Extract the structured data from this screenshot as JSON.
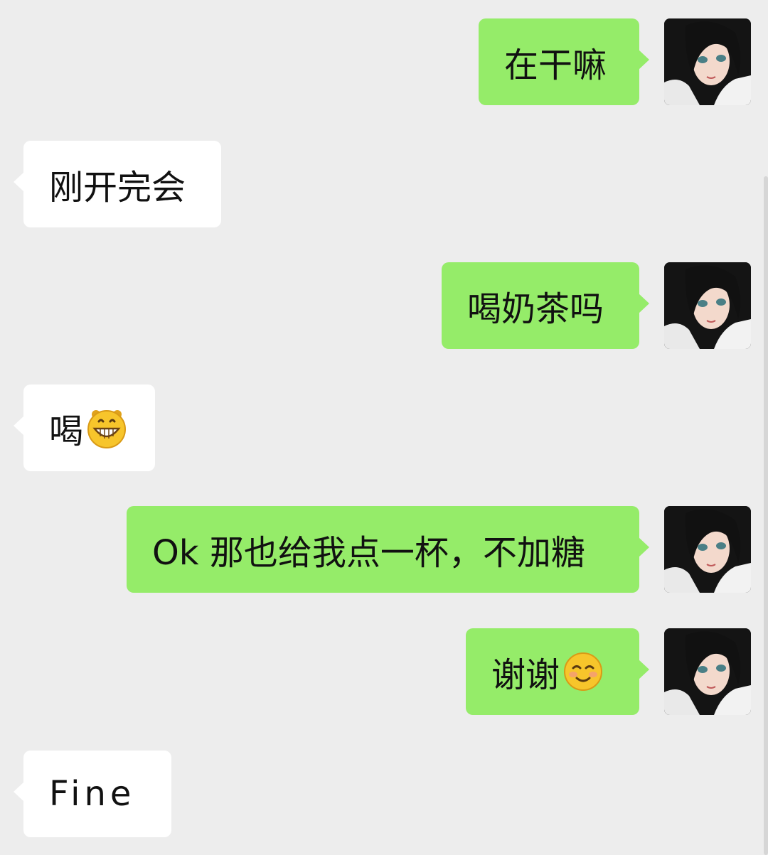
{
  "messages": [
    {
      "side": "out",
      "text": "在干嘛"
    },
    {
      "side": "in",
      "text": "刚开完会"
    },
    {
      "side": "out",
      "text": "喝奶茶吗"
    },
    {
      "side": "in",
      "text": "喝",
      "emoji": "grinning-face-emoji"
    },
    {
      "side": "out",
      "text": "Ok 那也给我点一杯，不加糖"
    },
    {
      "side": "out",
      "text": "谢谢",
      "emoji": "smiling-face-emoji"
    },
    {
      "side": "in",
      "text": "Fine"
    }
  ],
  "colors": {
    "background": "#ededed",
    "incoming_bubble": "#ffffff",
    "outgoing_bubble": "#95ec69",
    "text": "#111111"
  },
  "icons": {
    "avatar": "anime-girl-avatar"
  }
}
